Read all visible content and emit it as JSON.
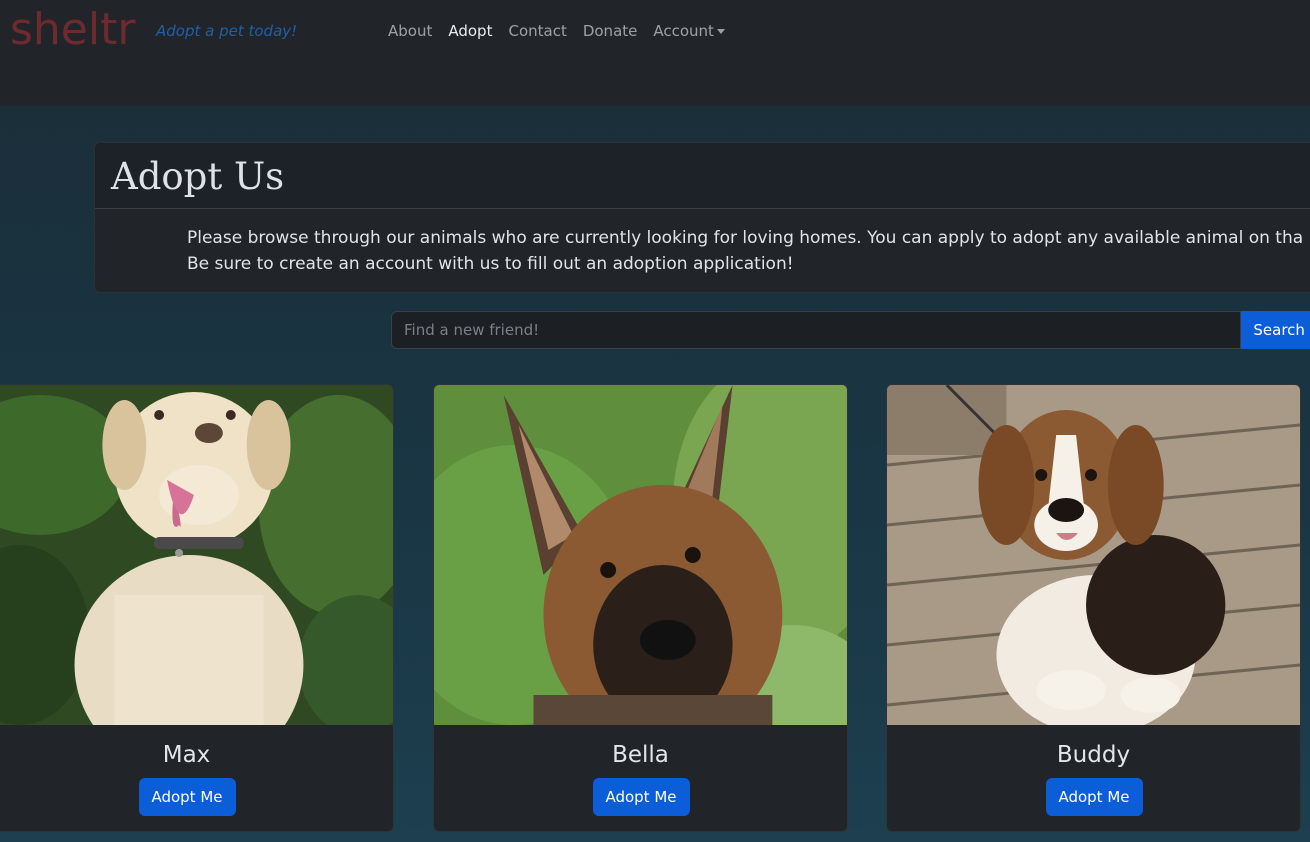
{
  "brand": {
    "name": "sheltr",
    "tagline": "Adopt a pet today!"
  },
  "nav": {
    "items": [
      {
        "label": "About"
      },
      {
        "label": "Adopt"
      },
      {
        "label": "Contact"
      },
      {
        "label": "Donate"
      },
      {
        "label": "Account"
      }
    ],
    "active": "Adopt"
  },
  "header": {
    "title": "Adopt Us",
    "intro_line1": "Please browse through our animals who are currently looking for loving homes. You can apply to adopt any available animal on tha",
    "intro_line2": "Be sure to create an account with us to fill out an adoption application!"
  },
  "search": {
    "placeholder": "Find a new friend!",
    "value": "",
    "button_label": "Search"
  },
  "pets": [
    {
      "name": "Max",
      "button_label": "Adopt Me",
      "photo": "yellow-labrador-photo"
    },
    {
      "name": "Bella",
      "button_label": "Adopt Me",
      "photo": "german-shepherd-puppy-photo"
    },
    {
      "name": "Buddy",
      "button_label": "Adopt Me",
      "photo": "beagle-photo"
    }
  ],
  "colors": {
    "accent": "#0b5ed7",
    "brand": "#6e2b2f",
    "tagline": "#1f5fa8",
    "navbar": "#212529"
  }
}
